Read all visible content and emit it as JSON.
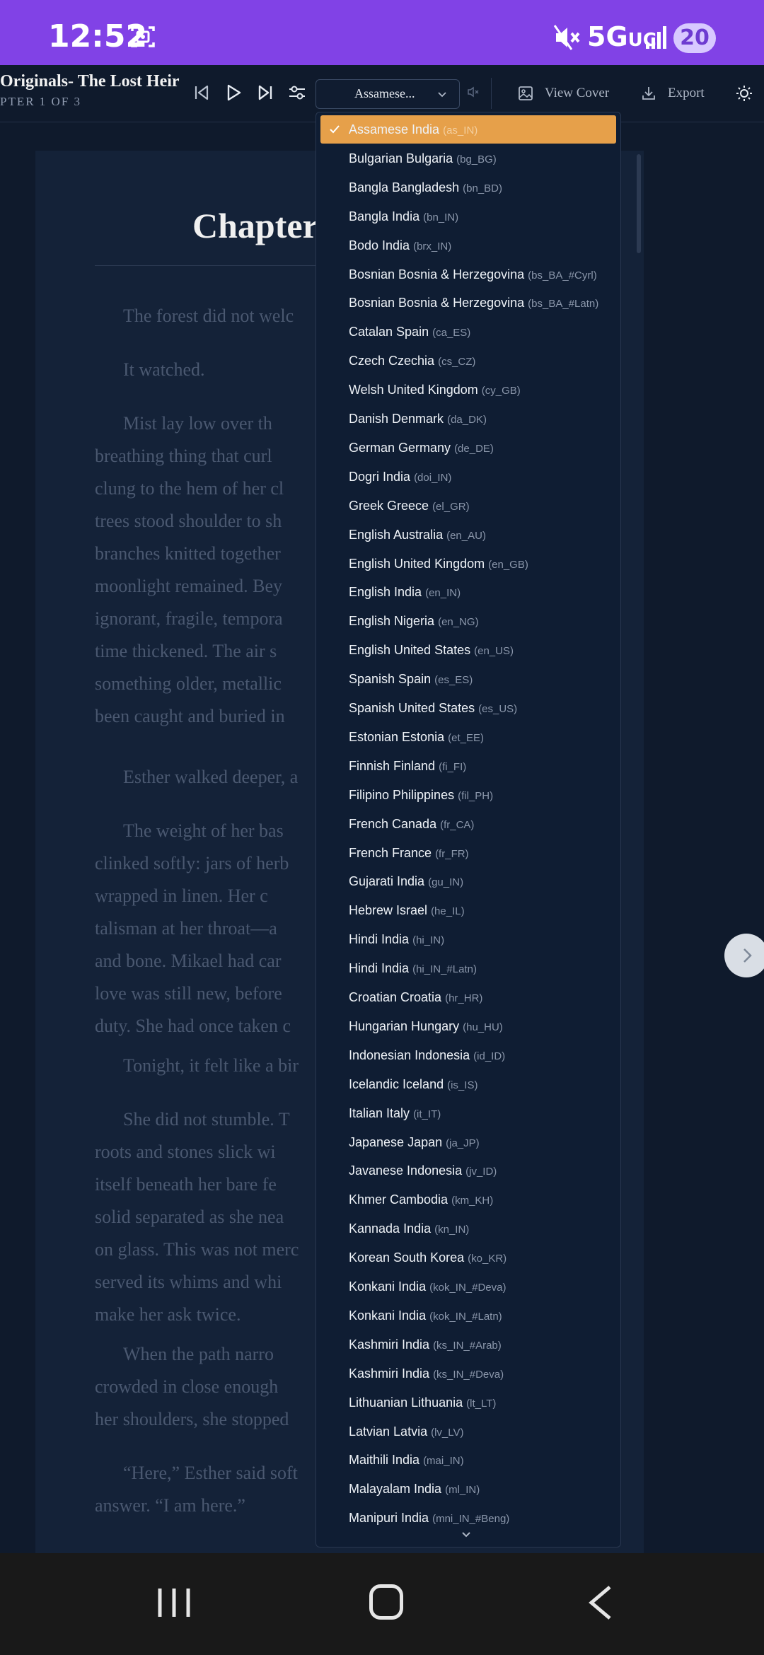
{
  "status_bar": {
    "time": "12:52",
    "network": "5G",
    "network_sub": "UC",
    "battery": "20"
  },
  "toolbar": {
    "book_title": "Originals- The Lost Heir",
    "chapter_info": "PTER 1 OF 3",
    "language_value": "Assamese...",
    "view_cover_label": "View Cover",
    "export_label": "Export"
  },
  "reader": {
    "chapter_title": "Chapter",
    "paragraphs": [
      {
        "lines": [
          "The forest did not welc"
        ]
      },
      {
        "lines": [
          "It watched."
        ]
      },
      {
        "lines": [
          "Mist lay low over th",
          "breathing thing that curl",
          "clung to the hem of her cl",
          "trees stood shoulder to sh",
          "branches knitted together",
          "moonlight remained. Bey",
          "ignorant, fragile, tempora",
          "time thickened. The air s",
          "something older, metallic",
          "been caught and buried in"
        ]
      },
      {
        "lines": [
          "Esther walked deeper, a"
        ]
      },
      {
        "lines": [
          "The weight of her bas",
          "clinked softly: jars of herb",
          "wrapped in linen. Her c",
          "talisman at her throat—a",
          "and bone. Mikael had car",
          "love was still new, before",
          "duty. She had once taken c"
        ]
      },
      {
        "lines": [
          "Tonight, it felt like a bir"
        ]
      },
      {
        "lines": [
          "She did not stumble. T",
          "roots and stones slick wi",
          "itself beneath her bare fe",
          "solid separated as she nea",
          "on glass. This was not merc",
          "served its whims and whi",
          "make her ask twice."
        ]
      },
      {
        "lines": [
          "When the path narro",
          "crowded in close enough",
          "her shoulders, she stopped"
        ]
      },
      {
        "lines": [
          "“Here,” Esther said soft",
          "answer. “I am here.”"
        ]
      }
    ]
  },
  "language_dropdown": {
    "selected_index": 0,
    "items": [
      {
        "name": "Assamese India",
        "code": "(as_IN)"
      },
      {
        "name": "Bulgarian Bulgaria",
        "code": "(bg_BG)"
      },
      {
        "name": "Bangla Bangladesh",
        "code": "(bn_BD)"
      },
      {
        "name": "Bangla India",
        "code": "(bn_IN)"
      },
      {
        "name": "Bodo India",
        "code": "(brx_IN)"
      },
      {
        "name": "Bosnian Bosnia & Herzegovina",
        "code": "(bs_BA_#Cyrl)"
      },
      {
        "name": "Bosnian Bosnia & Herzegovina",
        "code": "(bs_BA_#Latn)"
      },
      {
        "name": "Catalan Spain",
        "code": "(ca_ES)"
      },
      {
        "name": "Czech Czechia",
        "code": "(cs_CZ)"
      },
      {
        "name": "Welsh United Kingdom",
        "code": "(cy_GB)"
      },
      {
        "name": "Danish Denmark",
        "code": "(da_DK)"
      },
      {
        "name": "German Germany",
        "code": "(de_DE)"
      },
      {
        "name": "Dogri India",
        "code": "(doi_IN)"
      },
      {
        "name": "Greek Greece",
        "code": "(el_GR)"
      },
      {
        "name": "English Australia",
        "code": "(en_AU)"
      },
      {
        "name": "English United Kingdom",
        "code": "(en_GB)"
      },
      {
        "name": "English India",
        "code": "(en_IN)"
      },
      {
        "name": "English Nigeria",
        "code": "(en_NG)"
      },
      {
        "name": "English United States",
        "code": "(en_US)"
      },
      {
        "name": "Spanish Spain",
        "code": "(es_ES)"
      },
      {
        "name": "Spanish United States",
        "code": "(es_US)"
      },
      {
        "name": "Estonian Estonia",
        "code": "(et_EE)"
      },
      {
        "name": "Finnish Finland",
        "code": "(fi_FI)"
      },
      {
        "name": "Filipino Philippines",
        "code": "(fil_PH)"
      },
      {
        "name": "French Canada",
        "code": "(fr_CA)"
      },
      {
        "name": "French France",
        "code": "(fr_FR)"
      },
      {
        "name": "Gujarati India",
        "code": "(gu_IN)"
      },
      {
        "name": "Hebrew Israel",
        "code": "(he_IL)"
      },
      {
        "name": "Hindi India",
        "code": "(hi_IN)"
      },
      {
        "name": "Hindi India",
        "code": "(hi_IN_#Latn)"
      },
      {
        "name": "Croatian Croatia",
        "code": "(hr_HR)"
      },
      {
        "name": "Hungarian Hungary",
        "code": "(hu_HU)"
      },
      {
        "name": "Indonesian Indonesia",
        "code": "(id_ID)"
      },
      {
        "name": "Icelandic Iceland",
        "code": "(is_IS)"
      },
      {
        "name": "Italian Italy",
        "code": "(it_IT)"
      },
      {
        "name": "Japanese Japan",
        "code": "(ja_JP)"
      },
      {
        "name": "Javanese Indonesia",
        "code": "(jv_ID)"
      },
      {
        "name": "Khmer Cambodia",
        "code": "(km_KH)"
      },
      {
        "name": "Kannada India",
        "code": "(kn_IN)"
      },
      {
        "name": "Korean South Korea",
        "code": "(ko_KR)"
      },
      {
        "name": "Konkani India",
        "code": "(kok_IN_#Deva)"
      },
      {
        "name": "Konkani India",
        "code": "(kok_IN_#Latn)"
      },
      {
        "name": "Kashmiri India",
        "code": "(ks_IN_#Arab)"
      },
      {
        "name": "Kashmiri India",
        "code": "(ks_IN_#Deva)"
      },
      {
        "name": "Lithuanian Lithuania",
        "code": "(lt_LT)"
      },
      {
        "name": "Latvian Latvia",
        "code": "(lv_LV)"
      },
      {
        "name": "Maithili India",
        "code": "(mai_IN)"
      },
      {
        "name": "Malayalam India",
        "code": "(ml_IN)"
      },
      {
        "name": "Manipuri India",
        "code": "(mni_IN_#Beng)"
      }
    ]
  },
  "colors": {
    "status_bar": "#8142e6",
    "background": "#0f1a2c",
    "selected_item": "#e6a04a"
  }
}
